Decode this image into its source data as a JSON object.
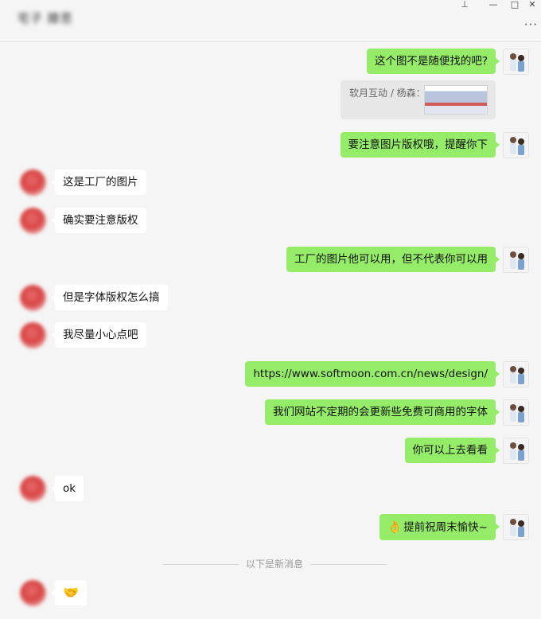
{
  "window": {
    "title": "宅子 滕思",
    "buttons": {
      "pin": "⊥",
      "minimize": "—",
      "maximize": "□",
      "close": "✕"
    },
    "more": "···"
  },
  "messages": [
    {
      "side": "me",
      "text": "这个图不是随便找的吧?"
    },
    {
      "side": "me",
      "type": "quote",
      "text": "软月互动 / 杨森："
    },
    {
      "side": "me",
      "text": "要注意图片版权哦，提醒你下"
    },
    {
      "side": "other",
      "text": "这是工厂的图片"
    },
    {
      "side": "other",
      "text": "确实要注意版权"
    },
    {
      "side": "me",
      "text": "工厂的图片他可以用，但不代表你可以用"
    },
    {
      "side": "other",
      "text": "但是字体版权怎么搞"
    },
    {
      "side": "other",
      "text": "我尽量小心点吧"
    },
    {
      "side": "me",
      "text": "https://www.softmoon.com.cn/news/design/",
      "link": true
    },
    {
      "side": "me",
      "text": "我们网站不定期的会更新些免费可商用的字体"
    },
    {
      "side": "me",
      "text": "你可以上去看看"
    },
    {
      "side": "other",
      "text": "ok"
    },
    {
      "side": "me",
      "text": "提前祝周末愉快~",
      "emoji": "👌"
    },
    {
      "side": "other",
      "text": "🤝",
      "emoji_only": true
    }
  ],
  "divider": "以下是新消息",
  "colors": {
    "me_bubble": "#95ec69",
    "other_bubble": "#ffffff",
    "background": "#f5f5f5"
  }
}
